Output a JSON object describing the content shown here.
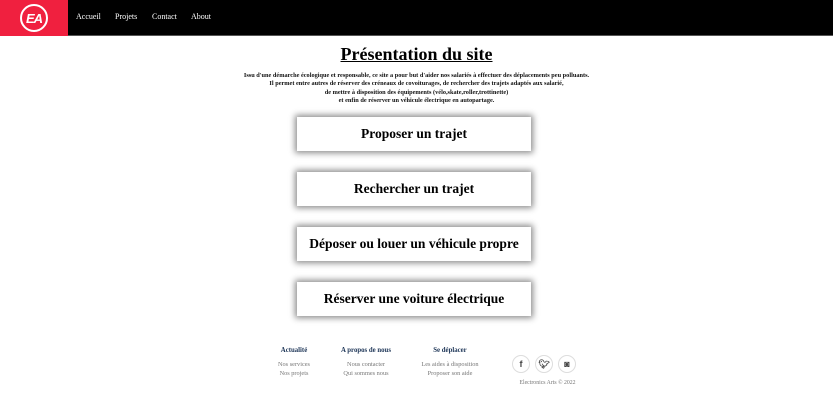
{
  "nav": {
    "logo": "EA",
    "items": [
      "Accueil",
      "Projets",
      "Contact",
      "About"
    ]
  },
  "title": "Présentation du site",
  "intro": [
    "Issu d'une démarche écologique et responsable, ce site a pour but d'aider nos salariés à effectuer des déplacements peu polluants.",
    "Il permet entre autres de réserver des créneaux de covoiturages, de rechercher des trajets adaptés aux salarié,",
    "de mettre à disposition des équipements (vélo,skate,roller,trottinette)",
    "et enfin de réserver un véhicule électrique en autopartage."
  ],
  "buttons": [
    "Proposer un trajet",
    "Rechercher un trajet",
    "Déposer ou louer un véhicule propre",
    "Réserver une voiture électrique"
  ],
  "footer": {
    "columns": [
      {
        "heading": "Actualité",
        "links": [
          "Nos services",
          "Nos projets"
        ]
      },
      {
        "heading": "A propos de nous",
        "links": [
          "Nous contacter",
          "Qui sommes nous"
        ]
      },
      {
        "heading": "Se déplacer",
        "links": [
          "Les aides à disposition",
          "Proposer son aide"
        ]
      }
    ],
    "social": [
      "facebook-icon",
      "twitter-icon",
      "instagram-icon"
    ],
    "copyright": "Electronics Arts © 2022"
  }
}
